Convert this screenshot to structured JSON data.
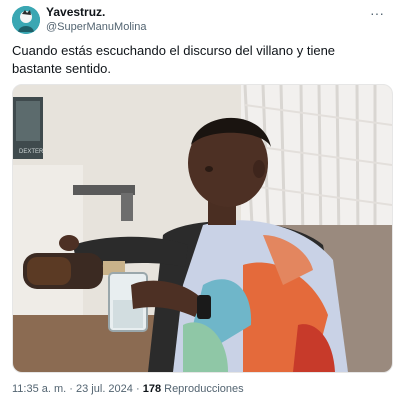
{
  "author": {
    "display_name": "Yavestruz.",
    "handle": "@SuperManuMolina"
  },
  "tweet": {
    "text": "Cuando estás escuchando el discurso del villano y tiene bastante sentido."
  },
  "meta": {
    "time": "11:35 a. m.",
    "separator": "·",
    "date": "23 jul. 2024",
    "views_count": "178",
    "views_label": "Reproducciones"
  },
  "media": {
    "description": "meme-man-pouring-drink",
    "poster_text": "DEXTER"
  },
  "icons": {
    "more": "more-options-icon",
    "avatar": "avatar"
  }
}
